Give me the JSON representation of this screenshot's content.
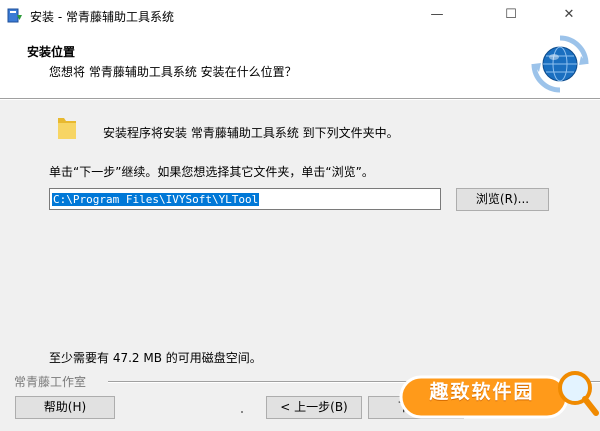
{
  "window": {
    "title": "安装 - 常青藤辅助工具系统",
    "minimize_glyph": "—",
    "maximize_glyph": "☐",
    "close_glyph": "✕"
  },
  "header": {
    "title": "安装位置",
    "subtitle": "您想将 常青藤辅助工具系统 安装在什么位置？"
  },
  "body": {
    "intro": "安装程序将安装 常青藤辅助工具系统 到下列文件夹中。",
    "instruction": "单击“下一步”继续。如果您想选择其它文件夹，单击“浏览”。",
    "install_path": "C:\\Program Files\\IVYSoft\\YLTool",
    "browse_label": "浏览(R)...",
    "space_required": "至少需要有 47.2 MB 的可用磁盘空间。"
  },
  "footer": {
    "brand": "常青藤工作室",
    "help_label": "帮助(H)",
    "back_label": "< 上一步(B)",
    "next_label": "下一步"
  },
  "watermark": {
    "text": "趣致软件园"
  },
  "icons": {
    "app": "installer-app-icon",
    "header": "globe-setup-icon",
    "folder": "folder-icon"
  },
  "colors": {
    "selection": "#0078d7",
    "globe": "#1a6fc0",
    "watermark_orange": "#ff9a1a"
  }
}
